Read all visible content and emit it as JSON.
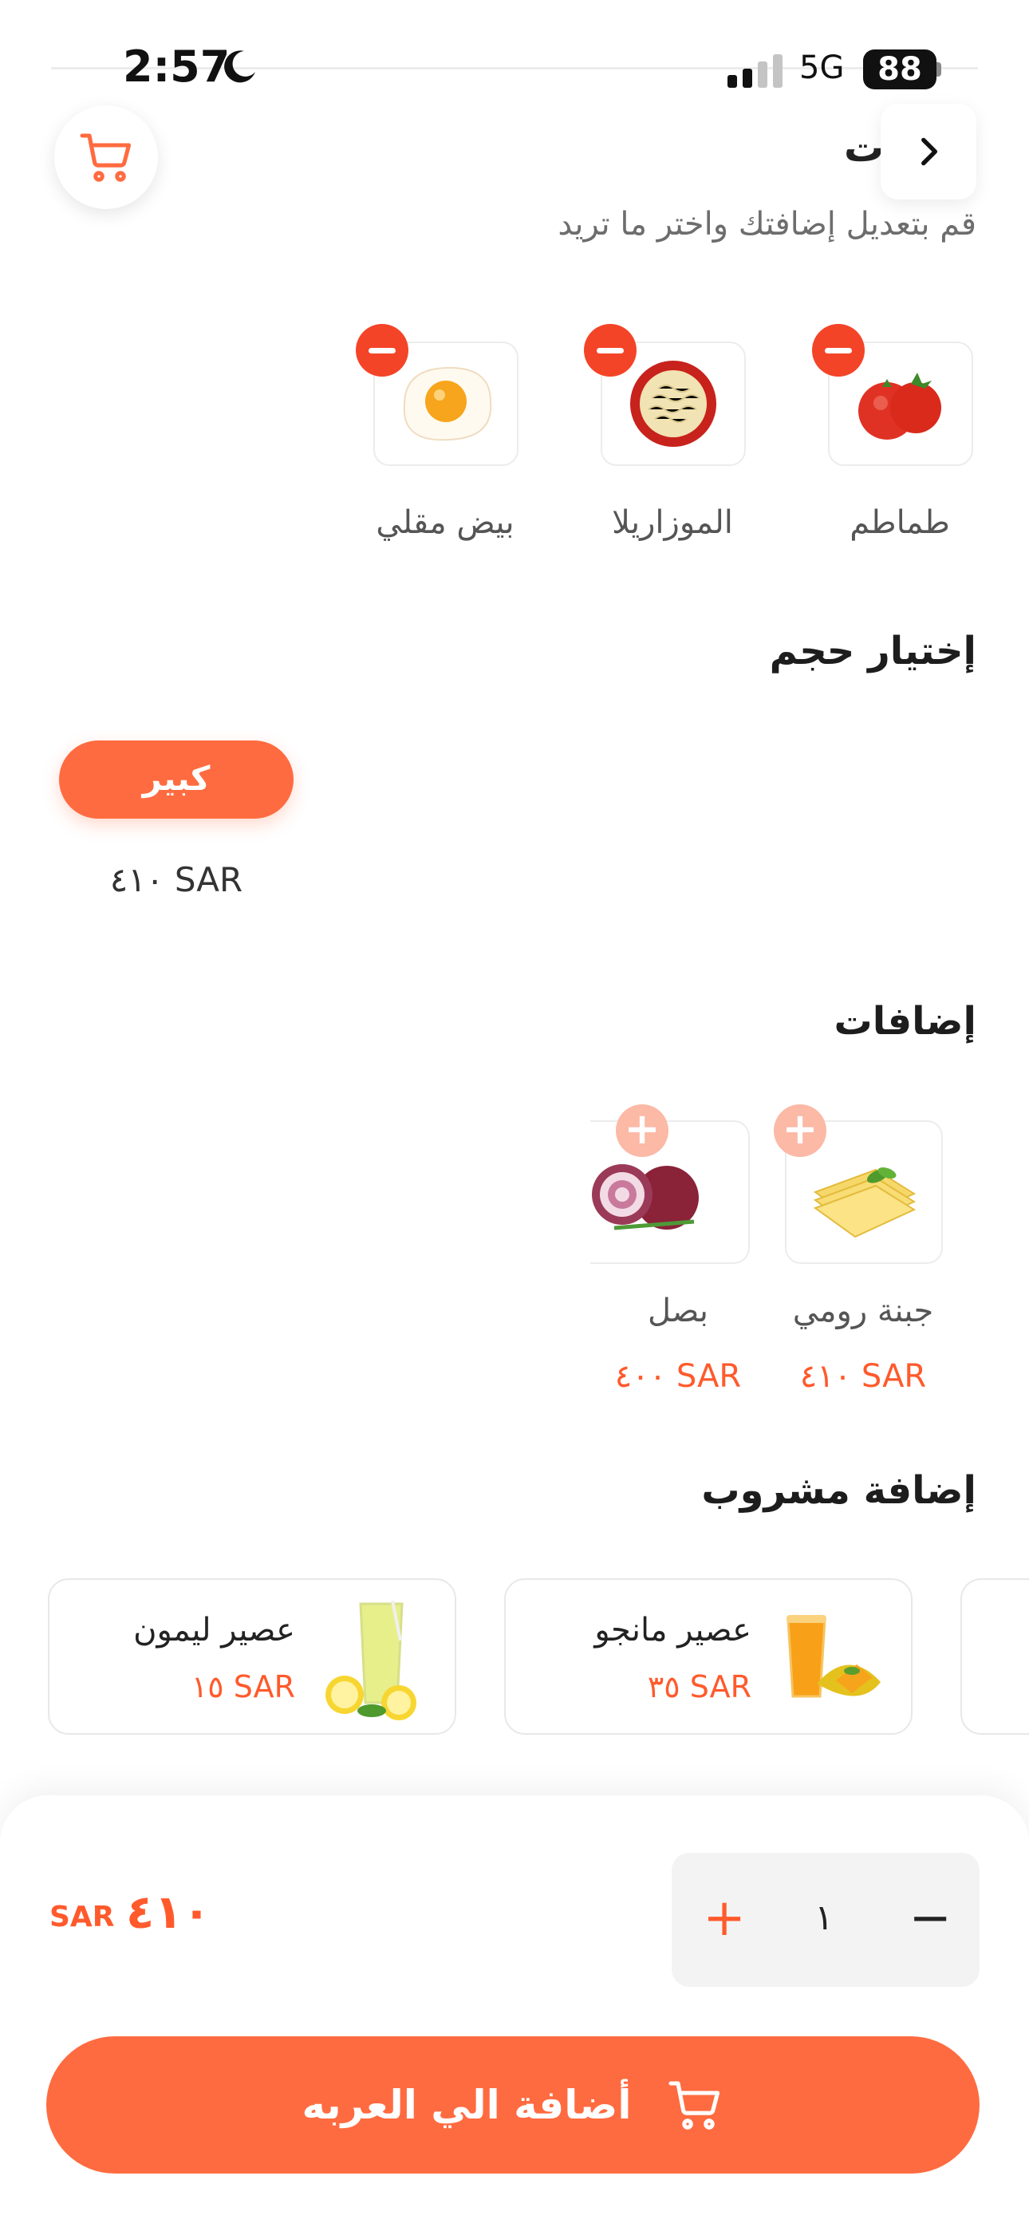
{
  "status_bar": {
    "time": "2:57",
    "network": "5G",
    "battery": "88"
  },
  "header": {
    "title_fragment": "ت",
    "subtitle": "قم بتعديل إضافتك واختر ما تريد"
  },
  "current_items": [
    {
      "label": "طماطم",
      "image": "tomato"
    },
    {
      "label": "الموزاريلا",
      "image": "mozzarella"
    },
    {
      "label": "بيض مقلي",
      "image": "fried-egg"
    }
  ],
  "size_section": {
    "title": "إختيار حجم",
    "option_label": "كبير",
    "option_price": "٤١٠ SAR"
  },
  "extras_section": {
    "title": "إضافات",
    "items": [
      {
        "label": "جبنة رومي",
        "price": "٤١٠ SAR",
        "image": "cheese"
      },
      {
        "label": "بصل",
        "price": "٤٠٠ SAR",
        "image": "onion"
      }
    ]
  },
  "drinks_section": {
    "title": "إضافة مشروب",
    "items": [
      {
        "name": "عصير مانجو",
        "price": "٣٥ SAR",
        "image": "mango-juice"
      },
      {
        "name": "عصير ليمون",
        "price": "١٥ SAR",
        "image": "lemon-juice"
      }
    ]
  },
  "footer": {
    "total_value": "٤١٠",
    "total_currency": "SAR",
    "quantity": "١",
    "add_button_label": "أضافة الي العربه"
  },
  "colors": {
    "accent": "#ff6b40",
    "price": "#ff5a2c",
    "remove": "#f44428",
    "add_badge": "#fbb9a6"
  }
}
